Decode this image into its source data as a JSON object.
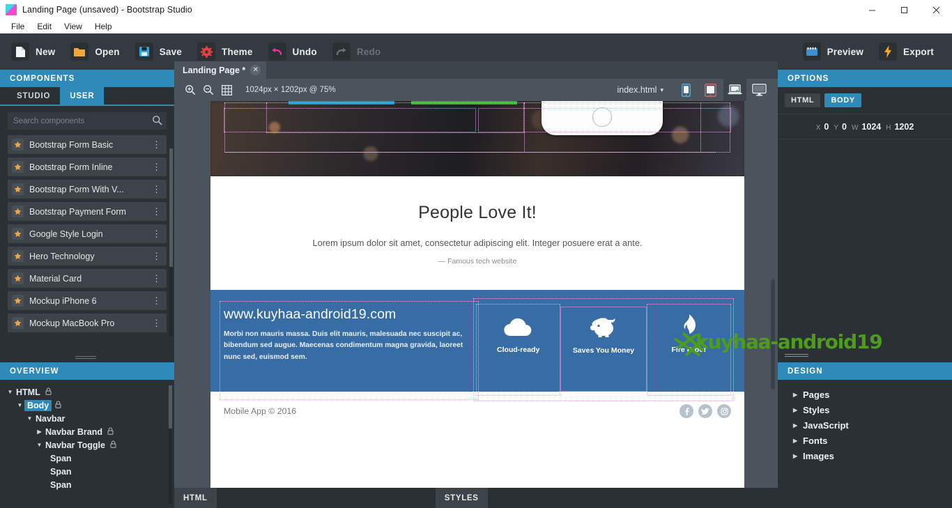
{
  "window": {
    "title": "Landing Page (unsaved) - Bootstrap Studio",
    "minimize": "–",
    "maximize": "□",
    "close": "✕"
  },
  "menubar": {
    "items": [
      "File",
      "Edit",
      "View",
      "Help"
    ]
  },
  "toolbar": {
    "left": [
      {
        "label": "New",
        "icon": "new-document-icon",
        "disabled": false
      },
      {
        "label": "Open",
        "icon": "open-folder-icon",
        "disabled": false
      },
      {
        "label": "Save",
        "icon": "save-disk-icon",
        "disabled": false
      },
      {
        "label": "Theme",
        "icon": "gear-icon",
        "disabled": false
      },
      {
        "label": "Undo",
        "icon": "undo-arrow-icon",
        "disabled": false
      },
      {
        "label": "Redo",
        "icon": "redo-arrow-icon",
        "disabled": true
      }
    ],
    "right": [
      {
        "label": "Preview",
        "icon": "preview-monitor-icon"
      },
      {
        "label": "Export",
        "icon": "export-bolt-icon"
      }
    ]
  },
  "components_panel": {
    "title": "COMPONENTS",
    "tabs": [
      {
        "label": "STUDIO",
        "active": false
      },
      {
        "label": "USER",
        "active": true
      }
    ],
    "search_placeholder": "Search components",
    "search_value": "",
    "items": [
      "Bootstrap Form Basic",
      "Bootstrap Form Inline",
      "Bootstrap Form With V...",
      "Bootstrap Payment Form",
      "Google Style Login",
      "Hero Technology",
      "Material Card",
      "Mockup iPhone 6",
      "Mockup MacBook Pro"
    ],
    "row_menu_glyph": "⋮"
  },
  "overview_panel": {
    "title": "OVERVIEW",
    "tree": [
      {
        "label": "HTML",
        "indent": 0,
        "arrow": "down",
        "locked": true,
        "selected": false
      },
      {
        "label": "Body",
        "indent": 1,
        "arrow": "down",
        "locked": true,
        "selected": true
      },
      {
        "label": "Navbar",
        "indent": 2,
        "arrow": "down",
        "locked": false,
        "selected": false
      },
      {
        "label": "Navbar Brand",
        "indent": 3,
        "arrow": "right",
        "locked": true,
        "selected": false
      },
      {
        "label": "Navbar Toggle",
        "indent": 3,
        "arrow": "down",
        "locked": true,
        "selected": false
      },
      {
        "label": "Span",
        "indent": 4,
        "arrow": "none",
        "locked": false,
        "selected": false
      },
      {
        "label": "Span",
        "indent": 4,
        "arrow": "none",
        "locked": false,
        "selected": false
      },
      {
        "label": "Span",
        "indent": 4,
        "arrow": "none",
        "locked": false,
        "selected": false
      }
    ]
  },
  "editor": {
    "document_tab": {
      "label": "Landing Page *",
      "close_glyph": "✕"
    },
    "canvas_bar": {
      "zoom_in_icon": "zoom-in-icon",
      "zoom_out_icon": "zoom-out-icon",
      "grid_icon": "grid-icon",
      "size_label": "1024px × 1202px @ 75%",
      "file_select": "index.html",
      "file_caret": "▾",
      "devices": [
        {
          "name": "phone",
          "active": false
        },
        {
          "name": "tablet",
          "active": false
        },
        {
          "name": "laptop",
          "active": true
        },
        {
          "name": "desktop",
          "active": false
        }
      ]
    },
    "bottom_tabs": [
      {
        "label": "HTML"
      },
      {
        "label": "STYLES"
      }
    ]
  },
  "preview": {
    "hero": {
      "button_primary_color": "#1c9ad6",
      "button_success_color": "#36b13b"
    },
    "testimonial": {
      "heading": "People Love It!",
      "lead": "Lorem ipsum dolor sit amet, consectetur adipiscing elit. Integer posuere erat a ante.",
      "source": "— Famous tech website"
    },
    "band": {
      "background": "#376ca5",
      "heading": "www.kuyhaa-android19.com",
      "paragraph": "Morbi non mauris massa. Duis elit mauris, malesuada nec suscipit ac, bibendum sed augue. Maecenas condimentum magna gravida, laoreet nunc sed, euismod sem.",
      "features": [
        {
          "label": "Cloud-ready",
          "icon": "cloud-icon",
          "outlined": false
        },
        {
          "label": "Saves You Money",
          "icon": "piggy-bank-icon",
          "outlined": true
        },
        {
          "label": "Fire Proof",
          "icon": "fire-icon",
          "outlined": false
        }
      ]
    },
    "footer": {
      "copyright": "Mobile App © 2016",
      "social": [
        {
          "name": "facebook-icon"
        },
        {
          "name": "twitter-icon"
        },
        {
          "name": "instagram-icon"
        }
      ]
    }
  },
  "options_panel": {
    "title": "OPTIONS",
    "tabs": [
      {
        "label": "HTML",
        "active": false
      },
      {
        "label": "BODY",
        "active": true
      }
    ],
    "coords": [
      {
        "key": "X",
        "value": "0"
      },
      {
        "key": "Y",
        "value": "0"
      },
      {
        "key": "W",
        "value": "1024"
      },
      {
        "key": "H",
        "value": "1202"
      }
    ]
  },
  "design_panel": {
    "title": "DESIGN",
    "items": [
      "Pages",
      "Styles",
      "JavaScript",
      "Fonts",
      "Images"
    ],
    "arrow": "▶"
  },
  "watermark": {
    "text": "kuyhaa-android19",
    "color": "#4e9c1e"
  }
}
